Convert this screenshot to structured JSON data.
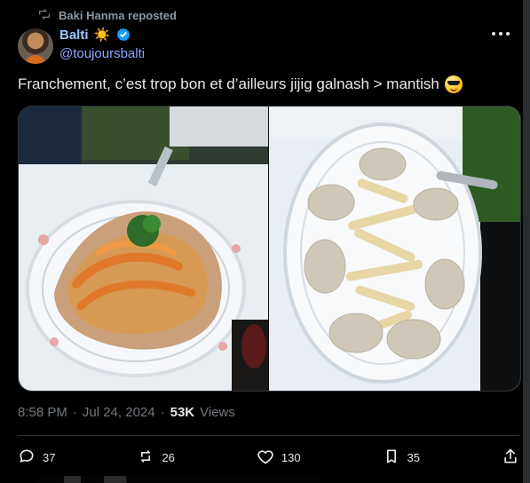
{
  "repost": {
    "label": "Baki Hanma reposted"
  },
  "author": {
    "name": "Balti",
    "name_emoji": "☀️",
    "handle": "@toujoursbalti"
  },
  "tweet": {
    "text": "Franchement, c’est trop bon et d’ailleurs jijig galnash > mantish"
  },
  "meta": {
    "time": "8:58 PM",
    "separator": "·",
    "date": "Jul 24, 2024",
    "views": "53K",
    "views_label": "Views"
  },
  "actions": {
    "replies": "37",
    "reposts": "26",
    "likes": "130",
    "bookmarks": "35"
  },
  "icons": {
    "repost": "repost-icon",
    "verified": "verified-badge-icon",
    "more": "more-horizontal-icon",
    "reply": "reply-icon",
    "retweet": "retweet-icon",
    "like": "heart-icon",
    "bookmark": "bookmark-icon",
    "share": "share-icon"
  },
  "colors": {
    "background": "#000000",
    "text": "#e7e9ea",
    "secondary": "#71767b",
    "accent": "#1d9bf0",
    "name": "#9ec5ff",
    "handle": "#8fa7ff"
  }
}
